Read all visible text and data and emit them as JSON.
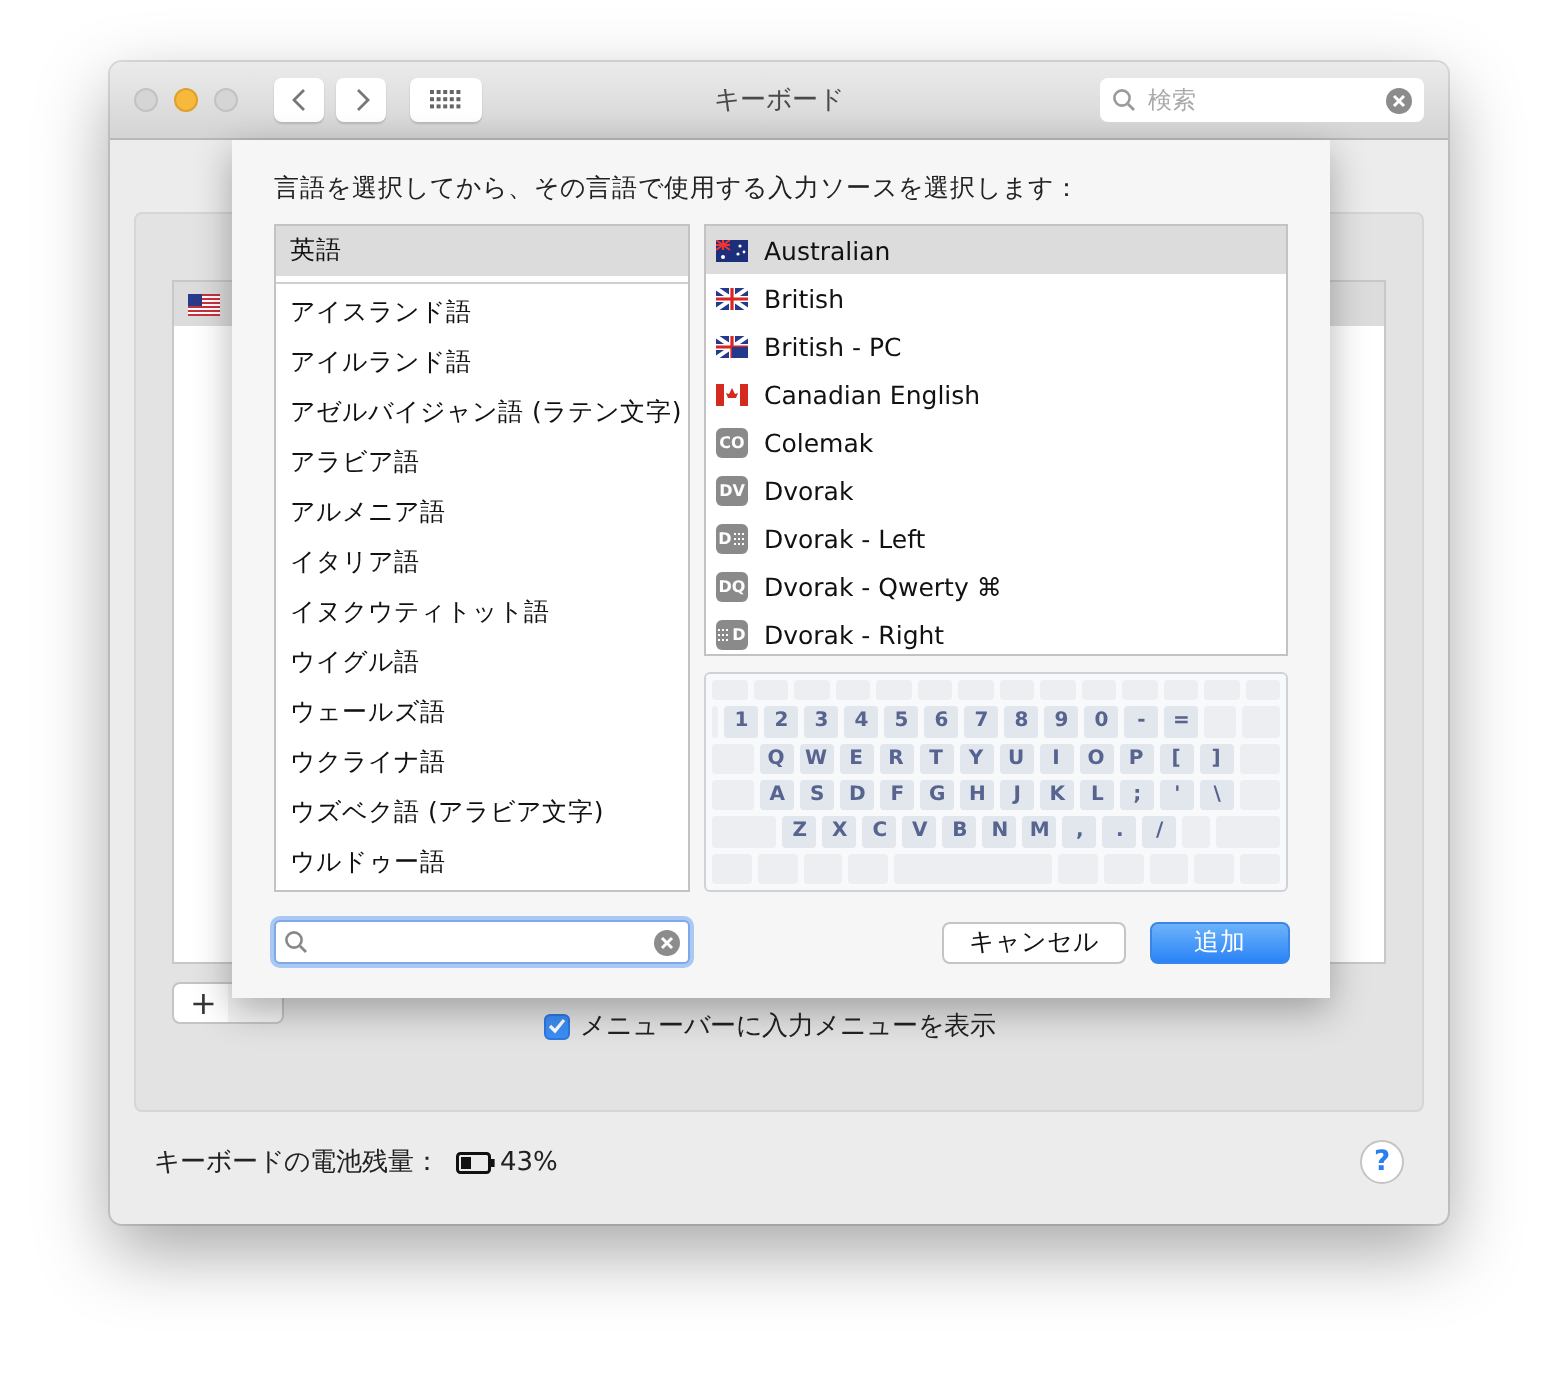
{
  "window": {
    "title": "キーボード",
    "search": {
      "placeholder": "検索"
    }
  },
  "input_sources": [
    {
      "kind": "us",
      "selected": true
    }
  ],
  "add_button": "+",
  "menu_checkbox": {
    "label": "メニューバーに入力メニューを表示",
    "checked": true
  },
  "battery": {
    "label": "キーボードの電池残量：",
    "reading": "43%"
  },
  "help": "?",
  "sheet": {
    "prompt": "言語を選択してから、その言語で使用する入力ソースを選択します：",
    "languages": [
      {
        "label": "英語",
        "selected": true
      },
      {
        "label": "アイスランド語",
        "selected": false
      },
      {
        "label": "アイルランド語",
        "selected": false
      },
      {
        "label": "アゼルバイジャン語 (ラテン文字)",
        "selected": false
      },
      {
        "label": "アラビア語",
        "selected": false
      },
      {
        "label": "アルメニア語",
        "selected": false
      },
      {
        "label": "イタリア語",
        "selected": false
      },
      {
        "label": "イヌクウティトット語",
        "selected": false
      },
      {
        "label": "ウイグル語",
        "selected": false
      },
      {
        "label": "ウェールズ語",
        "selected": false
      },
      {
        "label": "ウクライナ語",
        "selected": false
      },
      {
        "label": "ウズベク語 (アラビア文字)",
        "selected": false
      },
      {
        "label": "ウルドゥー語",
        "selected": false
      }
    ],
    "layouts": [
      {
        "label": "Australian",
        "kind": "au",
        "selected": true
      },
      {
        "label": "British",
        "kind": "gb",
        "selected": false
      },
      {
        "label": "British - PC",
        "kind": "gbpc",
        "selected": false
      },
      {
        "label": "Canadian English",
        "kind": "ca",
        "selected": false
      },
      {
        "label": "Colemak",
        "kind": "badge",
        "badge": "CO",
        "selected": false
      },
      {
        "label": "Dvorak",
        "kind": "badge",
        "badge": "DV",
        "selected": false
      },
      {
        "label": "Dvorak - Left",
        "kind": "badge-left",
        "badge": "D",
        "selected": false
      },
      {
        "label": "Dvorak - Qwerty ⌘",
        "kind": "badge",
        "badge": "DQ",
        "selected": false
      },
      {
        "label": "Dvorak - Right",
        "kind": "badge-right",
        "badge": "D",
        "selected": false
      }
    ],
    "keyboard": [
      [
        "1",
        "2",
        "3",
        "4",
        "5",
        "6",
        "7",
        "8",
        "9",
        "0",
        "-",
        "="
      ],
      [
        "Q",
        "W",
        "E",
        "R",
        "T",
        "Y",
        "U",
        "I",
        "O",
        "P",
        "[",
        "]"
      ],
      [
        "A",
        "S",
        "D",
        "F",
        "G",
        "H",
        "J",
        "K",
        "L",
        ";",
        "'",
        "\\"
      ],
      [
        "Z",
        "X",
        "C",
        "V",
        "B",
        "N",
        "M",
        ",",
        ".",
        "/"
      ]
    ],
    "buttons": [
      {
        "label": "キャンセル",
        "kind": "cancel"
      },
      {
        "label": "追加",
        "kind": "default"
      }
    ]
  }
}
